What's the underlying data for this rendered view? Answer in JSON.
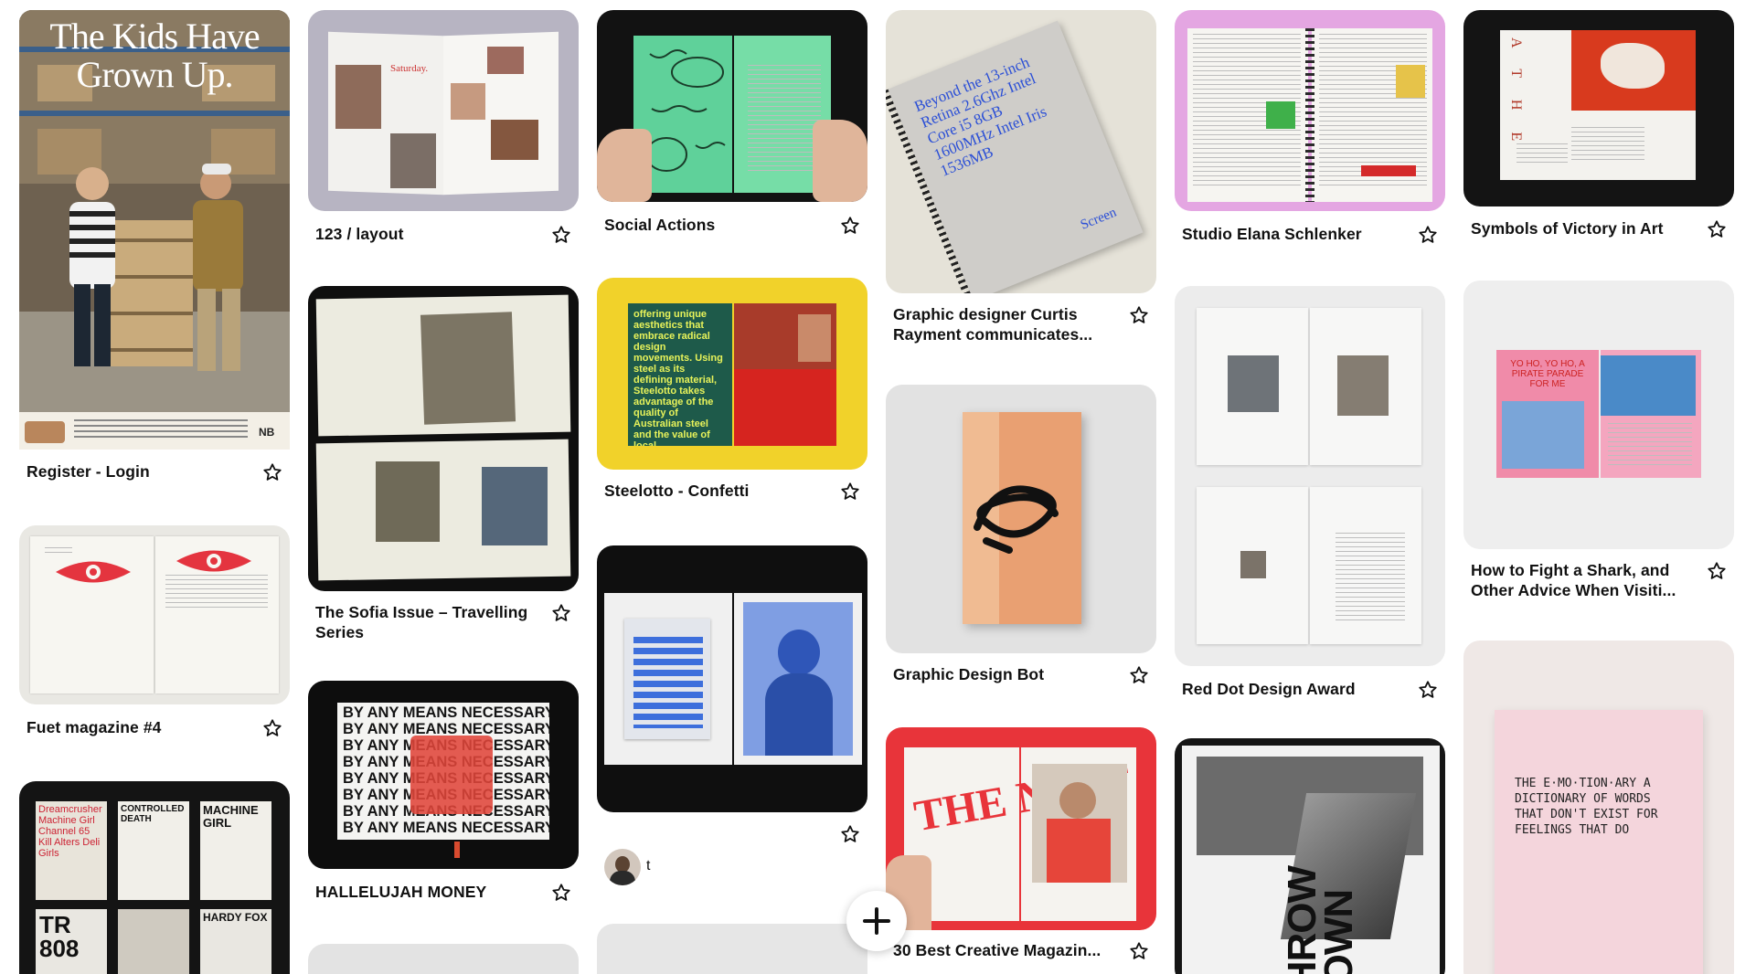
{
  "pins": {
    "c1": [
      {
        "caption": "Register - Login",
        "image": {
          "headline": "The Kids Have Grown Up."
        }
      },
      {
        "caption": "Fuet magazine #4"
      },
      {
        "caption": "",
        "image": {
          "poster_a": "Dreamcrusher Machine Girl Channel 65 Kill Alters Deli Girls",
          "poster_b": "CONTROLLED DEATH",
          "poster_c": "MACHINE GIRL",
          "poster_d": "TR 808",
          "poster_e": "HARDY FOX"
        }
      }
    ],
    "c2": [
      {
        "caption": "123 / layout",
        "image": {
          "spread_title": "Saturday."
        }
      },
      {
        "caption": "The Sofia Issue – Travelling Series"
      },
      {
        "caption": "HALLELUJAH MONEY",
        "image": {
          "repeat_line": "BY ANY MEANS NECESSARY"
        }
      },
      {
        "caption": ""
      }
    ],
    "c3": [
      {
        "caption": "Social Actions"
      },
      {
        "caption": "Steelotto - Confetti",
        "image": {
          "block_text": "offering unique aesthetics that embrace radical design movements. Using steel as its defining material, Steelotto takes advantage of the quality of Australian steel and the value of local manufacturing."
        }
      },
      {
        "caption": "",
        "user": "t"
      },
      {
        "caption": ""
      }
    ],
    "c4": [
      {
        "caption": "Graphic designer Curtis Rayment communicates...",
        "image": {
          "cover_text": "Beyond the 13-inch Retina 2.6Ghz Intel Core i5 8GB 1600MHz Intel Iris 1536MB",
          "label": "Screen"
        }
      },
      {
        "caption": "Graphic Design Bot"
      },
      {
        "caption": "30 Best Creative Magazin...",
        "image": {
          "title": "THE NEST"
        }
      }
    ],
    "c5": [
      {
        "caption": "Studio Elana Schlenker"
      },
      {
        "caption": "Red Dot Design Award"
      },
      {
        "caption": "",
        "image": {
          "title": "THROW DOWN"
        }
      }
    ],
    "c6": [
      {
        "caption": "Symbols of Victory in Art",
        "image": {
          "letters": "A T H E"
        }
      },
      {
        "caption": "How to Fight a Shark, and Other Advice When Visiti...",
        "image": {
          "spread_text": "YO HO, YO HO, A PIRATE PARADE FOR ME"
        }
      },
      {
        "caption": "",
        "image": {
          "cover_title": "THE E·MO·TION·ARY A DICTIONARY OF WORDS THAT DON'T EXIST FOR FEELINGS THAT DO"
        }
      }
    ]
  },
  "icons": {
    "favorite": "star-outline-icon",
    "add": "plus-icon"
  },
  "colors": {
    "background": "#ffffff",
    "card_placeholder": "#e8e8e8",
    "text": "#111111"
  }
}
